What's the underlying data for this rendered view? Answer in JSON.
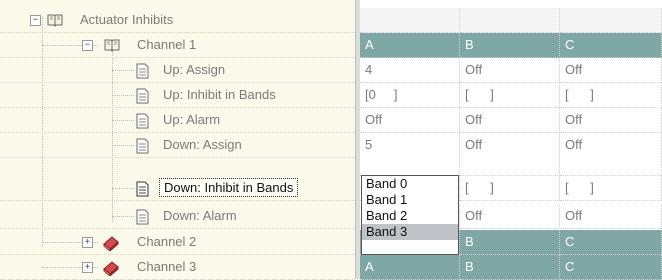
{
  "tree": {
    "root_label": "Actuator Inhibits",
    "items": [
      {
        "label": "Channel 1",
        "expander": "⊟",
        "icon": "open-book-icon"
      },
      {
        "label": "Up: Assign",
        "icon": "document-icon"
      },
      {
        "label": "Up: Inhibit in Bands",
        "icon": "document-icon"
      },
      {
        "label": "Up: Alarm",
        "icon": "document-icon"
      },
      {
        "label": "Down: Assign",
        "icon": "document-icon"
      },
      {
        "label": "Down: Inhibit in Bands",
        "icon": "document-icon"
      },
      {
        "label": "Down: Alarm",
        "icon": "document-icon"
      },
      {
        "label": "Channel 2",
        "expander": "⊞",
        "icon": "closed-book-icon"
      },
      {
        "label": "Channel 3",
        "expander": "⊞",
        "icon": "closed-book-icon"
      }
    ],
    "expander_minus": "−",
    "expander_plus": "+"
  },
  "grid": {
    "channel1_headers": [
      "A",
      "B",
      "C"
    ],
    "up_assign": [
      "4",
      "Off",
      "Off"
    ],
    "up_inhibit": [
      "[0     ]",
      "[      ]",
      "[      ]"
    ],
    "up_alarm": [
      "Off",
      "Off",
      "Off"
    ],
    "down_assign": [
      "5",
      "Off",
      "Off"
    ],
    "down_inhibit": [
      "",
      "[      ]",
      "[      ]"
    ],
    "down_alarm": [
      "",
      "Off",
      "Off"
    ],
    "channel2_headers": [
      "",
      "B",
      "C"
    ],
    "channel3_headers": [
      "A",
      "B",
      "C"
    ]
  },
  "dropdown": {
    "options": [
      "Band 0",
      "Band 1",
      "Band 2",
      "Band 3"
    ],
    "selected_index": 3
  },
  "colors": {
    "tree_bg": "#fbf9ea",
    "header_bg": "#7fa8a4",
    "dropdown_selected": "#bfc3c7"
  }
}
